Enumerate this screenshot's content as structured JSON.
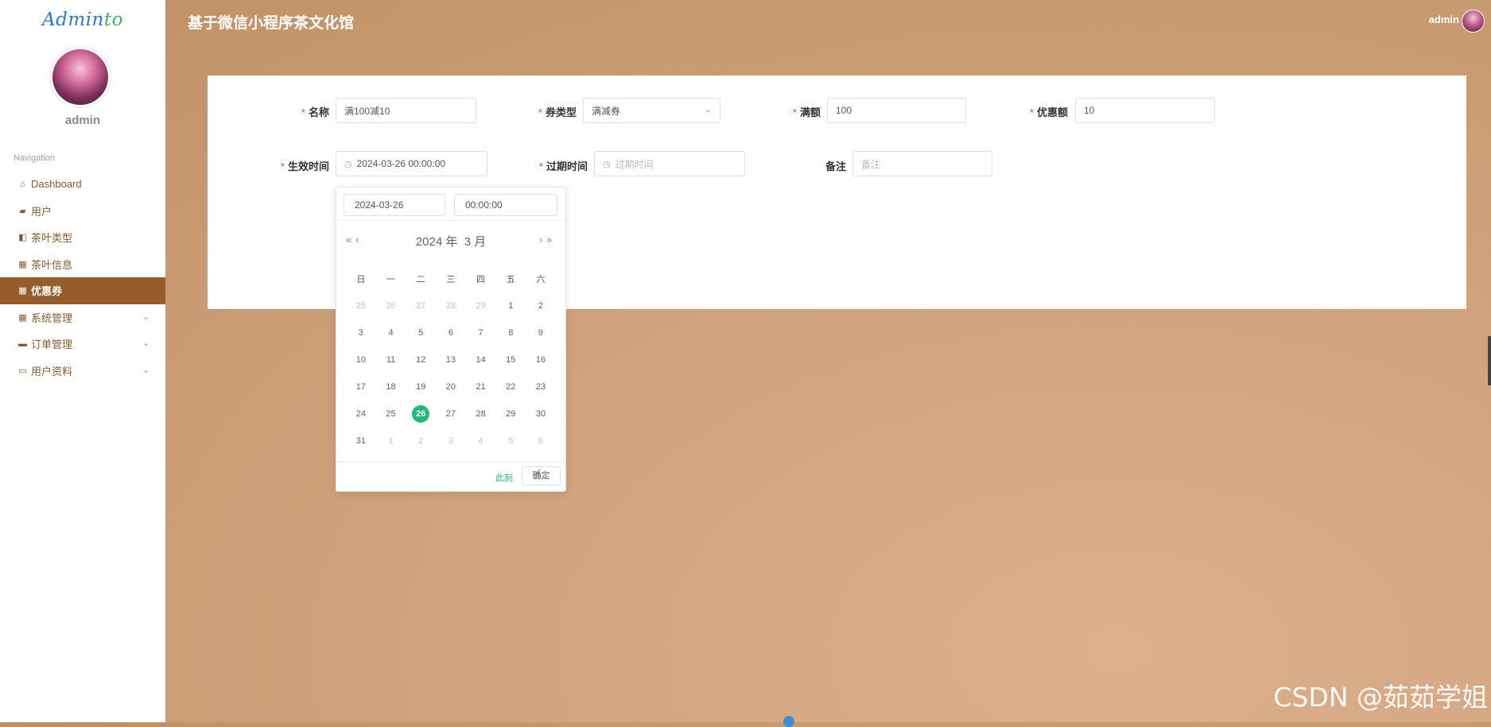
{
  "sidebar": {
    "logo_main": "Admin",
    "logo_accent": "to",
    "user_name": "admin",
    "nav_label": "Navigation",
    "items": [
      {
        "icon": "⌂",
        "label": "Dashboard"
      },
      {
        "icon": "▰",
        "label": "用户"
      },
      {
        "icon": "◧",
        "label": "茶叶类型"
      },
      {
        "icon": "▦",
        "label": "茶叶信息"
      },
      {
        "icon": "▦",
        "label": "优惠券"
      },
      {
        "icon": "▦",
        "label": "系统管理",
        "chevron": "⌄"
      },
      {
        "icon": "▬",
        "label": "订单管理",
        "chevron": "⌄"
      },
      {
        "icon": "▭",
        "label": "用户资料",
        "chevron": "⌄"
      }
    ]
  },
  "header": {
    "title": "基于微信小程序茶文化馆",
    "user": "admin"
  },
  "form": {
    "name": {
      "label": "名称",
      "value": "满100减10"
    },
    "type": {
      "label": "券类型",
      "value": "满减券"
    },
    "threshold": {
      "label": "满额",
      "value": "100"
    },
    "discount": {
      "label": "优惠额",
      "value": "10"
    },
    "start": {
      "label": "生效时间",
      "value": "2024-03-26 00:00:00"
    },
    "expire": {
      "label": "过期时间",
      "placeholder": "过期时间"
    },
    "remark": {
      "label": "备注",
      "placeholder": "备注"
    }
  },
  "picker": {
    "date_value": "2024-03-26",
    "time_value": "00:00:00",
    "year_label": "2024 年",
    "month_label": "3 月",
    "prev_year": "«",
    "prev_month": "‹",
    "next_month": "›",
    "next_year": "»",
    "weekdays": [
      "日",
      "一",
      "二",
      "三",
      "四",
      "五",
      "六"
    ],
    "weeks": [
      [
        {
          "d": "25",
          "m": 1
        },
        {
          "d": "26",
          "m": 1
        },
        {
          "d": "27",
          "m": 1
        },
        {
          "d": "28",
          "m": 1
        },
        {
          "d": "29",
          "m": 1
        },
        {
          "d": "1"
        },
        {
          "d": "2"
        }
      ],
      [
        {
          "d": "3"
        },
        {
          "d": "4"
        },
        {
          "d": "5"
        },
        {
          "d": "6"
        },
        {
          "d": "7"
        },
        {
          "d": "8"
        },
        {
          "d": "9"
        }
      ],
      [
        {
          "d": "10"
        },
        {
          "d": "11"
        },
        {
          "d": "12"
        },
        {
          "d": "13"
        },
        {
          "d": "14"
        },
        {
          "d": "15"
        },
        {
          "d": "16"
        }
      ],
      [
        {
          "d": "17"
        },
        {
          "d": "18"
        },
        {
          "d": "19"
        },
        {
          "d": "20"
        },
        {
          "d": "21"
        },
        {
          "d": "22"
        },
        {
          "d": "23"
        }
      ],
      [
        {
          "d": "24"
        },
        {
          "d": "25"
        },
        {
          "d": "26",
          "sel": 1
        },
        {
          "d": "27"
        },
        {
          "d": "28"
        },
        {
          "d": "29"
        },
        {
          "d": "30"
        }
      ],
      [
        {
          "d": "31"
        },
        {
          "d": "1",
          "m": 1
        },
        {
          "d": "2",
          "m": 1
        },
        {
          "d": "3",
          "m": 1
        },
        {
          "d": "4",
          "m": 1
        },
        {
          "d": "5",
          "m": 1
        },
        {
          "d": "6",
          "m": 1
        }
      ]
    ],
    "now_label": "此刻",
    "confirm_label": "确定"
  },
  "watermark": "CSDN @茹茹学姐",
  "colors": {
    "accent": "#965d2b",
    "selected_day": "#21b977"
  }
}
